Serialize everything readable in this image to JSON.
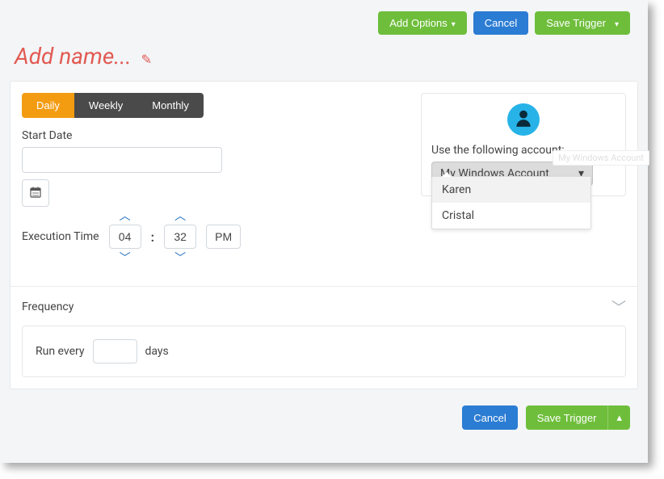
{
  "topButtons": {
    "addOptions": "Add Options",
    "cancel": "Cancel",
    "saveTrigger": "Save Trigger"
  },
  "title": "Add name...",
  "tabs": {
    "daily": "Daily",
    "weekly": "Weekly",
    "monthly": "Monthly"
  },
  "startDateLabel": "Start Date",
  "startDateValue": "",
  "executionTimeLabel": "Execution Time",
  "time": {
    "hour": "04",
    "minute": "32",
    "ampm": "PM"
  },
  "frequency": {
    "title": "Frequency",
    "runEvery": "Run every",
    "daysValue": "",
    "daysLabel": "days"
  },
  "account": {
    "label": "Use the following account:",
    "selected": "My Windows Account",
    "options": [
      "Karen",
      "Cristal"
    ],
    "tooltip": "My Windows Account"
  },
  "bottomButtons": {
    "cancel": "Cancel",
    "saveTrigger": "Save Trigger"
  }
}
